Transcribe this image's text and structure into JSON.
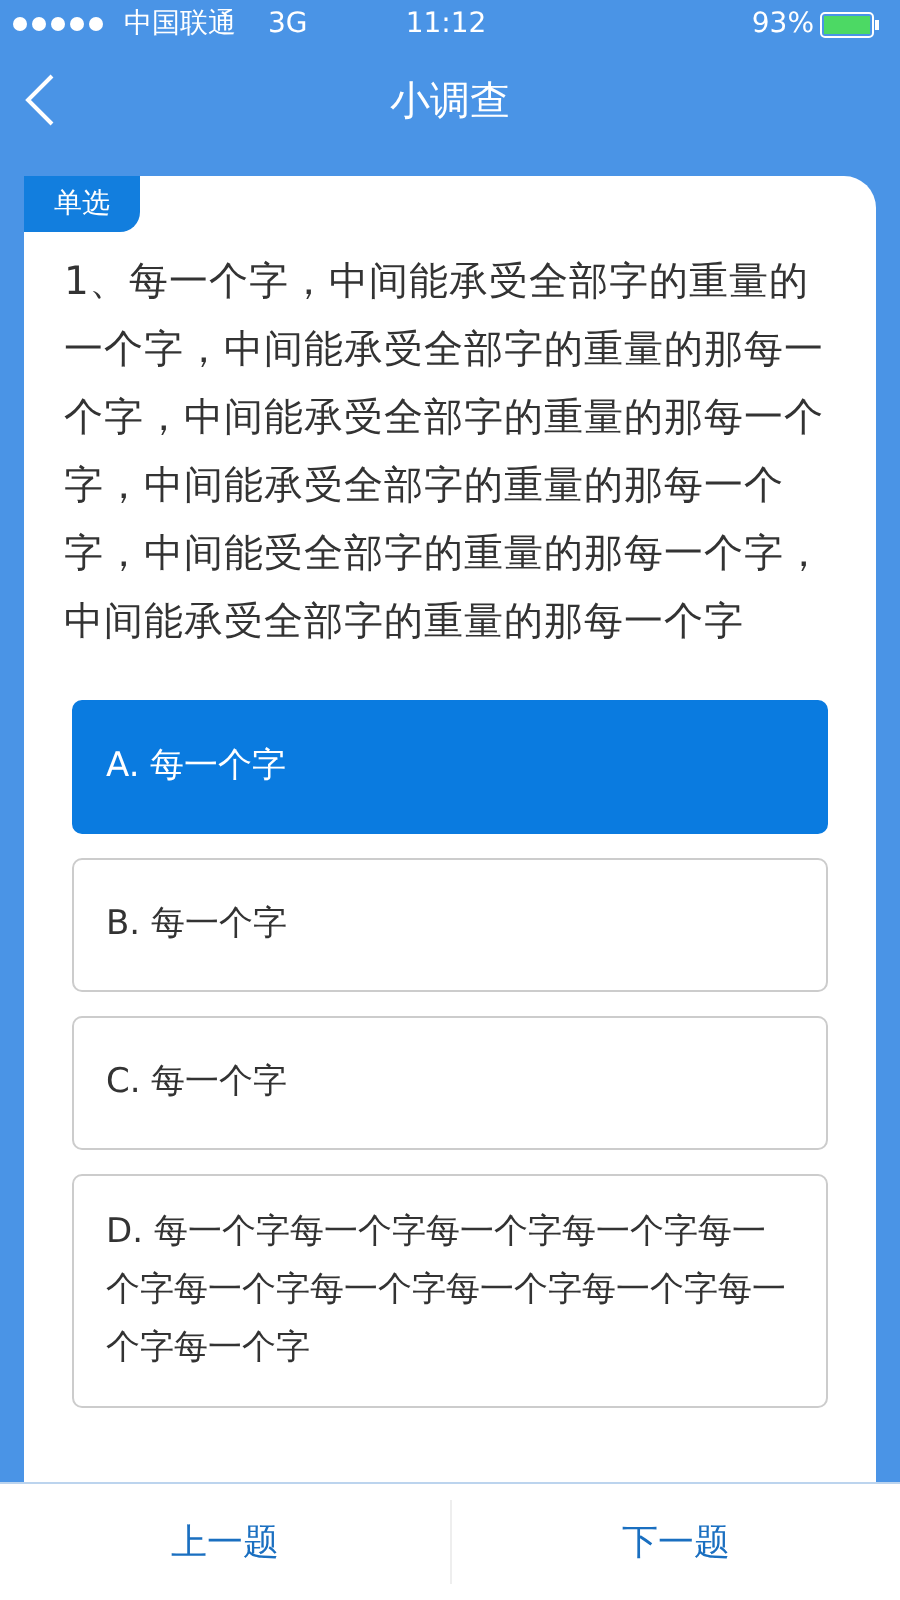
{
  "status_bar": {
    "carrier": "中国联通",
    "network": "3G",
    "time": "11:12",
    "battery": "93%"
  },
  "nav": {
    "title": "小调查"
  },
  "question": {
    "type_badge": "单选",
    "text": "1、每一个字，中间能承受全部字的重量的一个字，中间能承受全部字的重量的那每一个字，中间能承受全部字的重量的那每一个字，中间能承受全部字的重量的那每一个字，中间能受全部字的重量的那每一个字，中间能承受全部字的重量的那每一个字"
  },
  "options": [
    {
      "label": "A. 每一个字",
      "selected": true
    },
    {
      "label": "B. 每一个字",
      "selected": false
    },
    {
      "label": "C. 每一个字",
      "selected": false
    },
    {
      "label": "D. 每一个字每一个字每一个字每一个字每一个字每一个字每一个字每一个字每一个字每一个字每一个字",
      "selected": false
    }
  ],
  "footer": {
    "prev": "上一题",
    "next": "下一题"
  }
}
